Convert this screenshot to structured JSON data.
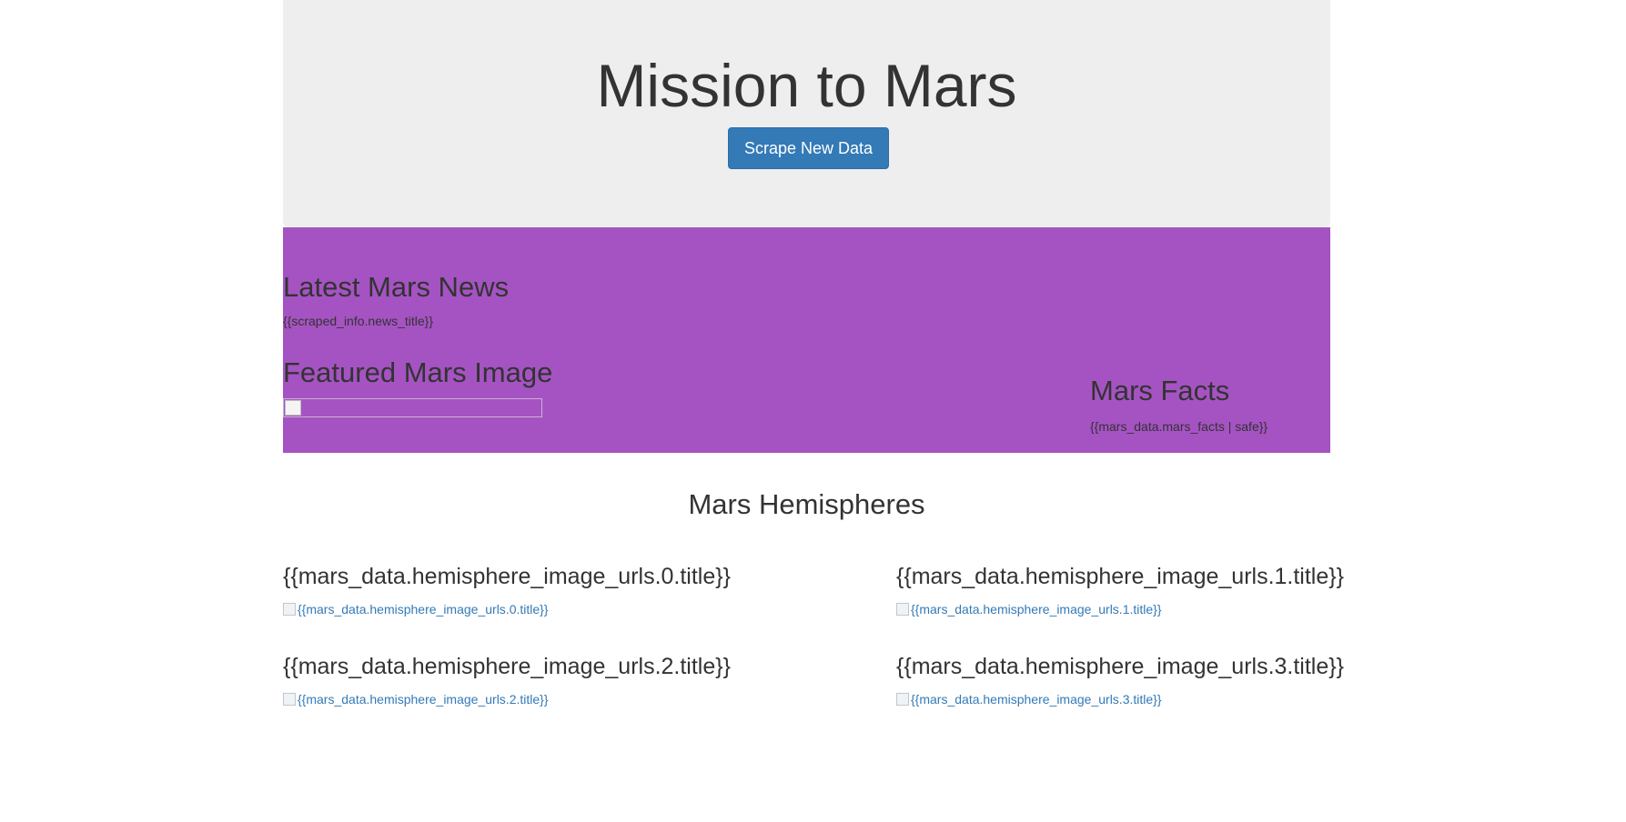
{
  "jumbotron": {
    "title": "Mission to Mars",
    "button_label": "Scrape New Data"
  },
  "news": {
    "heading": "Latest Mars News",
    "text": "{{scraped_info.news_title}}"
  },
  "featured_image": {
    "heading": "Featured Mars Image"
  },
  "facts": {
    "heading": "Mars Facts",
    "text": "{{mars_data.mars_facts | safe}}"
  },
  "hemispheres": {
    "heading": "Mars Hemispheres",
    "items": [
      {
        "title": "{{mars_data.hemisphere_image_urls.0.title}}",
        "img_alt": "{{mars_data.hemisphere_image_urls.0.title}}"
      },
      {
        "title": "{{mars_data.hemisphere_image_urls.1.title}}",
        "img_alt": "{{mars_data.hemisphere_image_urls.1.title}}"
      },
      {
        "title": "{{mars_data.hemisphere_image_urls.2.title}}",
        "img_alt": "{{mars_data.hemisphere_image_urls.2.title}}"
      },
      {
        "title": "{{mars_data.hemisphere_image_urls.3.title}}",
        "img_alt": "{{mars_data.hemisphere_image_urls.3.title}}"
      }
    ]
  },
  "colors": {
    "jumbotron_bg": "#eeeeee",
    "primary": "#337ab7",
    "purple_section": "#a553c2"
  }
}
